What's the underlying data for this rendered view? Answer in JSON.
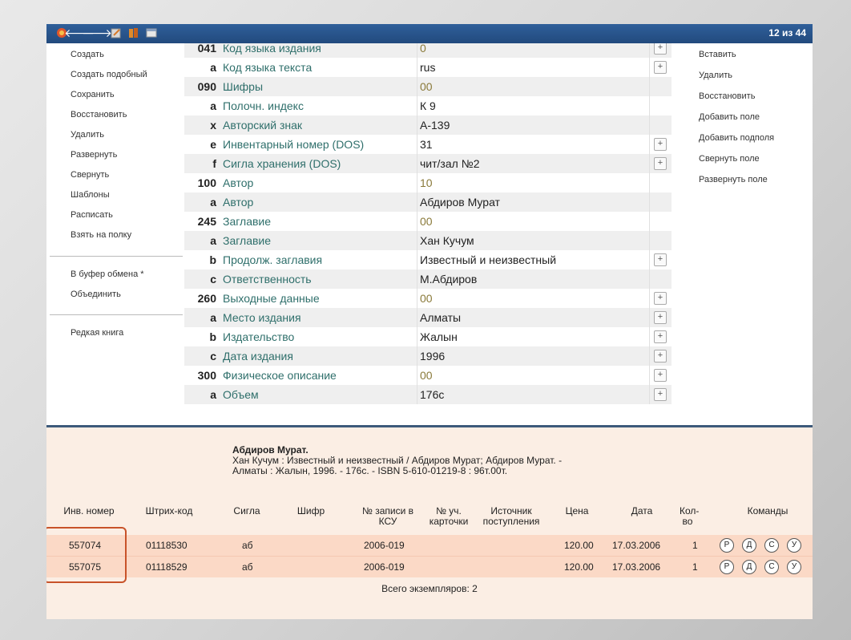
{
  "toolbar": {
    "count": "12 из 44"
  },
  "left_menu": {
    "items": [
      "Создать",
      "Создать подобный",
      "Сохранить",
      "Восстановить",
      "Удалить",
      "Развернуть",
      "Свернуть",
      "Шаблоны",
      "Расписать",
      "Взять на полку"
    ],
    "clipboard": [
      "В буфер обмена *",
      "Объединить"
    ],
    "rare": "Редкая книга"
  },
  "right_menu": {
    "items": [
      "Вставить",
      "Удалить",
      "Восстановить",
      "Добавить поле",
      "Добавить подполя",
      "Свернуть поле",
      "Развернуть поле"
    ]
  },
  "marc": {
    "rows": [
      {
        "tag": "041",
        "name": "Код языка издания",
        "value": "0",
        "code": true,
        "plus": true
      },
      {
        "tag": "a",
        "name": "Код языка текста",
        "value": "rus",
        "code": false,
        "plus": true
      },
      {
        "tag": "090",
        "name": "Шифры",
        "value": "00",
        "code": true,
        "plus": false
      },
      {
        "tag": "a",
        "name": "Полочн. индекс",
        "value": "К 9",
        "code": false,
        "plus": false
      },
      {
        "tag": "x",
        "name": "Авторский знак",
        "value": "А-139",
        "code": false,
        "plus": false
      },
      {
        "tag": "e",
        "name": "Инвентарный номер (DOS)",
        "value": "31",
        "code": false,
        "plus": true
      },
      {
        "tag": "f",
        "name": "Сигла хранения (DOS)",
        "value": "чит/зал №2",
        "code": false,
        "plus": true
      },
      {
        "tag": "100",
        "name": "Автор",
        "value": "10",
        "code": true,
        "plus": false
      },
      {
        "tag": "a",
        "name": "Автор",
        "value": "Абдиров Мурат",
        "code": false,
        "plus": false
      },
      {
        "tag": "245",
        "name": "Заглавие",
        "value": "00",
        "code": true,
        "plus": false
      },
      {
        "tag": "a",
        "name": "Заглавие",
        "value": "Хан Кучум",
        "code": false,
        "plus": false
      },
      {
        "tag": "b",
        "name": "Продолж. заглавия",
        "value": "Известный и неизвестный",
        "code": false,
        "plus": true
      },
      {
        "tag": "c",
        "name": "Ответственность",
        "value": "М.Абдиров",
        "code": false,
        "plus": false
      },
      {
        "tag": "260",
        "name": "Выходные данные",
        "value": "00",
        "code": true,
        "plus": true
      },
      {
        "tag": "a",
        "name": "Место издания",
        "value": "Алматы",
        "code": false,
        "plus": true
      },
      {
        "tag": "b",
        "name": "Издательство",
        "value": "Жалын",
        "code": false,
        "plus": true
      },
      {
        "tag": "c",
        "name": "Дата издания",
        "value": "1996",
        "code": false,
        "plus": true
      },
      {
        "tag": "300",
        "name": "Физическое описание",
        "value": "00",
        "code": true,
        "plus": true
      },
      {
        "tag": "a",
        "name": "Объем",
        "value": "176с",
        "code": false,
        "plus": true
      }
    ]
  },
  "description": {
    "author": "Абдиров Мурат.",
    "line1": "Хан Кучум : Известный и неизвестный / Абдиров Мурат; Абдиров Мурат. -",
    "line2": "Алматы : Жалын, 1996. - 176с. - ISBN 5-610-01219-8 : 96т.00т."
  },
  "table": {
    "headers": {
      "inv": "Инв. номер",
      "barcode": "Штрих-код",
      "sigla": "Сигла",
      "shifr": "Шифр",
      "ksu": "№ записи в КСУ",
      "card": "№ уч. карточки",
      "source": "Источник поступления",
      "price": "Цена",
      "date": "Дата",
      "qty": "Кол-во",
      "commands": "Команды"
    },
    "rows": [
      {
        "inv": "557074",
        "barcode": "01118530",
        "sigla": "аб",
        "ksu": "2006-019",
        "price": "120.00",
        "date": "17.03.2006",
        "qty": "1"
      },
      {
        "inv": "557075",
        "barcode": "01118529",
        "sigla": "аб",
        "ksu": "2006-019",
        "price": "120.00",
        "date": "17.03.2006",
        "qty": "1"
      }
    ],
    "commands": [
      "Р",
      "Д",
      "С",
      "У"
    ],
    "total": "Всего экземпляров: 2"
  }
}
